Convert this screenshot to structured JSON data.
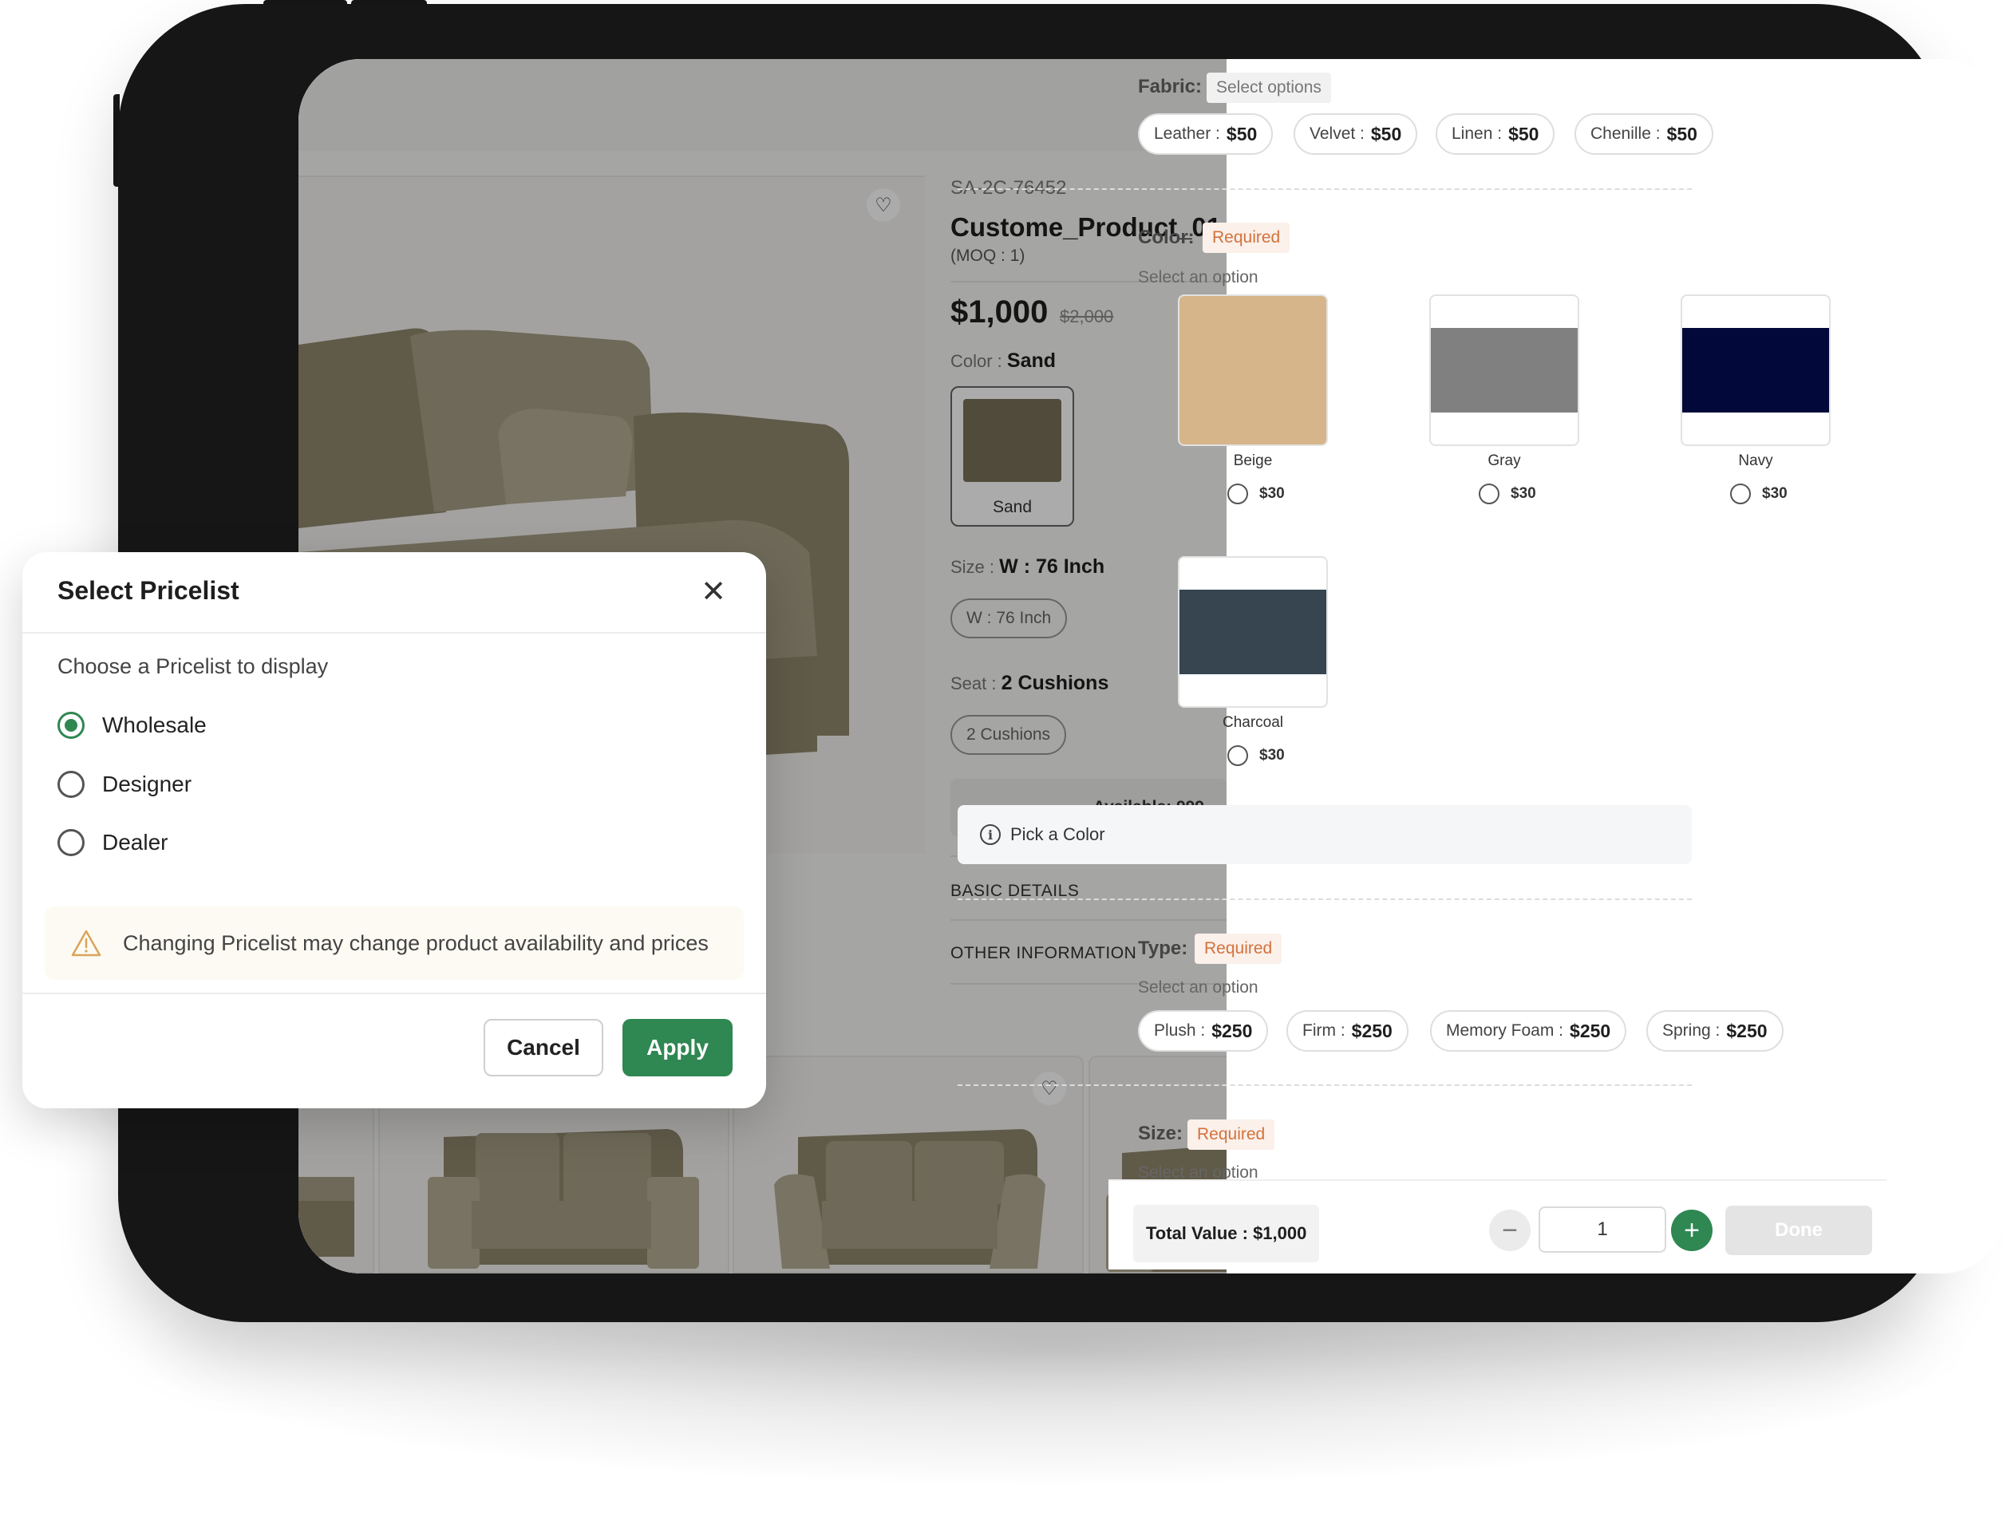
{
  "product": {
    "sku": "SA-2C-76452",
    "name": "Custome_Product_01",
    "moq": "(MOQ : 1)",
    "price": "$1,000",
    "old_price": "$2,000",
    "color_label": "Color :",
    "color_value": "Sand",
    "swatch_label": "Sand",
    "size_label": "Size :",
    "size_value": "W : 76 Inch",
    "size_pill": "W : 76 Inch",
    "seat_label": "Seat :",
    "seat_value": "2 Cushions",
    "seat_pill": "2 Cushions",
    "available": "Available: 999",
    "basic_details": "BASIC DETAILS",
    "other_information": "OTHER INFORMATION"
  },
  "options": {
    "fabric": {
      "label": "Fabric:",
      "chip": "Select options",
      "items": [
        {
          "name": "Leather :",
          "price": "$50"
        },
        {
          "name": "Velvet :",
          "price": "$50"
        },
        {
          "name": "Linen :",
          "price": "$50"
        },
        {
          "name": "Chenille :",
          "price": "$50"
        }
      ]
    },
    "color": {
      "label": "Color:",
      "chip": "Required",
      "sub": "Select an option",
      "items": [
        {
          "name": "Beige",
          "price": "$30",
          "hex": "#d5b589"
        },
        {
          "name": "Gray",
          "price": "$30",
          "hex": "#808080"
        },
        {
          "name": "Navy",
          "price": "$30",
          "hex": "#020839"
        },
        {
          "name": "Charcoal",
          "price": "$30",
          "hex": "#36454f"
        }
      ],
      "pick_label": "Pick a Color"
    },
    "type": {
      "label": "Type:",
      "chip": "Required",
      "sub": "Select an option",
      "items": [
        {
          "name": "Plush :",
          "price": "$250"
        },
        {
          "name": "Firm :",
          "price": "$250"
        },
        {
          "name": "Memory Foam :",
          "price": "$250"
        },
        {
          "name": "Spring :",
          "price": "$250"
        }
      ]
    },
    "size": {
      "label": "Size:",
      "chip": "Required",
      "sub": "Select an option"
    }
  },
  "footer": {
    "total": "Total Value : $1,000",
    "quantity": "1",
    "done": "Done"
  },
  "modal": {
    "title": "Select Pricelist",
    "subtitle": "Choose a Pricelist to display",
    "options": [
      {
        "label": "Wholesale",
        "selected": true
      },
      {
        "label": "Designer",
        "selected": false
      },
      {
        "label": "Dealer",
        "selected": false
      }
    ],
    "warning": "Changing Pricelist may change product availability and prices",
    "cancel": "Cancel",
    "apply": "Apply"
  },
  "colors": {
    "accent": "#2f8752",
    "required": "#d2723c",
    "sofa": "#a59d83"
  }
}
